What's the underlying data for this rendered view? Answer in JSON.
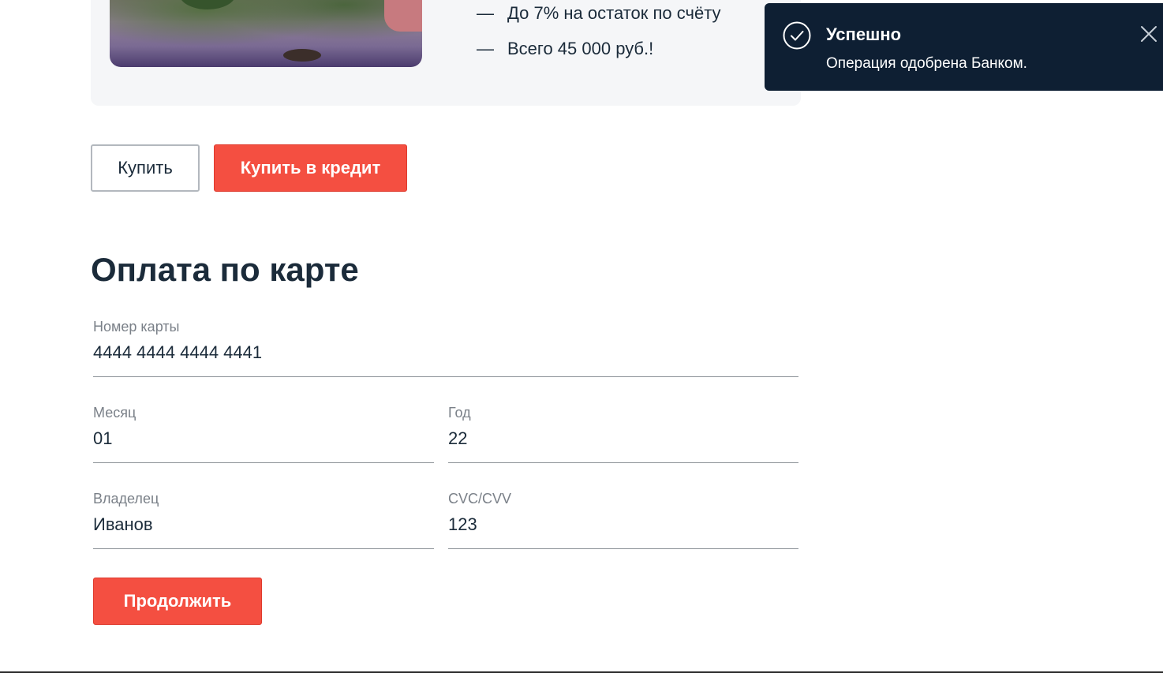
{
  "tour": {
    "features": [
      {
        "dash": "—",
        "text": "До 7% на остаток по счёту"
      },
      {
        "dash": "—",
        "text": "Всего 45 000 руб.!"
      }
    ]
  },
  "actions": {
    "buy_label": "Купить",
    "buy_credit_label": "Купить в кредит"
  },
  "payment": {
    "title": "Оплата по карте",
    "fields": {
      "card_number": {
        "label": "Номер карты",
        "value": "4444 4444 4444 4441"
      },
      "month": {
        "label": "Месяц",
        "value": "01"
      },
      "year": {
        "label": "Год",
        "value": "22"
      },
      "owner": {
        "label": "Владелец",
        "value": "Иванов"
      },
      "cvc": {
        "label": "CVC/CVV",
        "value": "123"
      }
    },
    "continue_label": "Продолжить"
  },
  "notification": {
    "title": "Успешно",
    "message": "Операция одобрена Банком.",
    "icons": {
      "status": "check-circle-icon",
      "close": "close-icon"
    }
  },
  "colors": {
    "accent": "#f44f41",
    "toast_background": "#0e1f33",
    "text": "#1b2b3a",
    "card_background": "#f5f6f8"
  }
}
